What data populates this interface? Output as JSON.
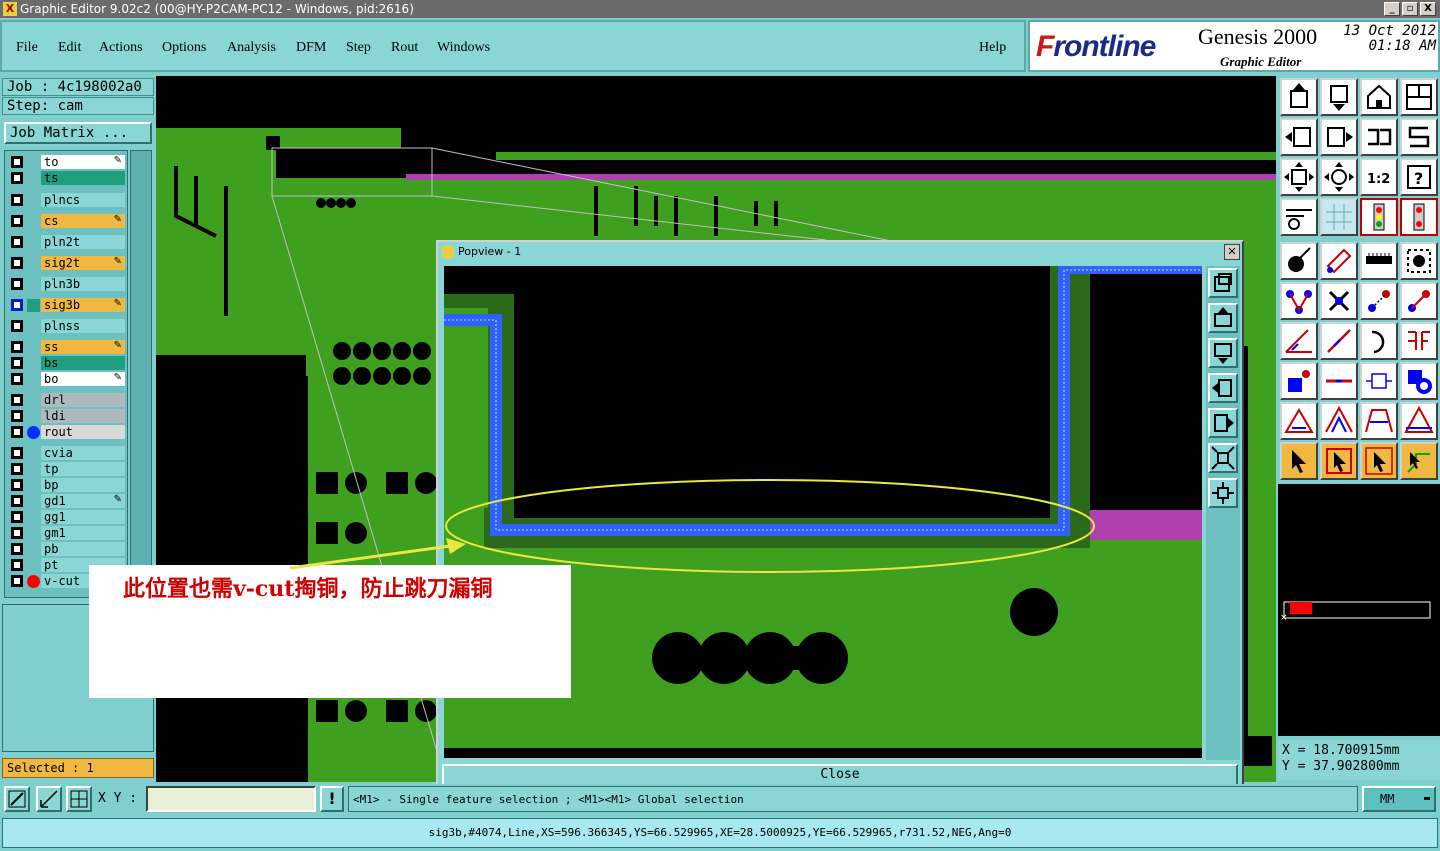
{
  "window": {
    "title": "Graphic Editor 9.02c2 (00@HY-P2CAM-PC12 - Windows, pid:2616)",
    "buttons": [
      "_",
      "▫",
      "X"
    ]
  },
  "menu": {
    "items": [
      "File",
      "Edit",
      "Actions",
      "Options",
      "Analysis",
      "DFM",
      "Step",
      "Rout",
      "Windows"
    ],
    "help": "Help"
  },
  "brand": {
    "logo_prefix": "F",
    "logo_rest": "rontline",
    "product": "Genesis 2000",
    "subtitle": "Graphic Editor",
    "date": "13 Oct 2012",
    "time": "01:18 AM"
  },
  "left": {
    "job": "Job : 4c198002a0",
    "step": "Step: cam",
    "job_matrix": "Job Matrix ...",
    "selected": "Selected : 1",
    "layers": [
      {
        "name": "to",
        "bg": "#ffffff",
        "editable": true
      },
      {
        "name": "ts",
        "bg": "#1f9f7f"
      },
      {
        "name": "plncs",
        "bg": "#8ad6d6"
      },
      {
        "name": "cs",
        "bg": "#f0b840",
        "editable": true
      },
      {
        "name": "pln2t",
        "bg": "#8ad6d6"
      },
      {
        "name": "sig2t",
        "bg": "#f0b840",
        "editable": true
      },
      {
        "name": "pln3b",
        "bg": "#8ad6d6"
      },
      {
        "name": "sig3b",
        "bg": "#f0b840",
        "editable": true,
        "work": true
      },
      {
        "name": "plnss",
        "bg": "#8ad6d6"
      },
      {
        "name": "ss",
        "bg": "#f0b840",
        "editable": true
      },
      {
        "name": "bs",
        "bg": "#1f9f7f"
      },
      {
        "name": "bo",
        "bg": "#ffffff",
        "editable": true
      },
      {
        "name": "drl",
        "bg": "#b0b8c0"
      },
      {
        "name": "ldi",
        "bg": "#b0b8c0"
      },
      {
        "name": "rout",
        "bg": "#d8d8d8",
        "marker": "#0030ff"
      },
      {
        "name": "cvia",
        "bg": "#8ad6d6"
      },
      {
        "name": "tp",
        "bg": "#8ad6d6"
      },
      {
        "name": "bp",
        "bg": "#8ad6d6"
      },
      {
        "name": "gd1",
        "bg": "#8ad6d6",
        "editable": true
      },
      {
        "name": "gg1",
        "bg": "#8ad6d6"
      },
      {
        "name": "gm1",
        "bg": "#8ad6d6"
      },
      {
        "name": "pb",
        "bg": "#8ad6d6"
      },
      {
        "name": "pt",
        "bg": "#8ad6d6"
      },
      {
        "name": "v-cut",
        "bg": "#8ad6d6",
        "marker": "#ff0000"
      }
    ]
  },
  "popview": {
    "title": "Popview - 1",
    "close": "Close"
  },
  "annotation": {
    "text": "此位置也需v-cut掏铜，防止跳刀漏铜"
  },
  "coords": {
    "x": "X  = 18.700915mm",
    "y": "Y  = 37.902800mm"
  },
  "bottom": {
    "xy_label": "X Y :",
    "xy_value": "",
    "hint": "<M1> - Single feature selection ; <M1><M1> Global selection",
    "units": "MM",
    "status": "sig3b,#4074,Line,XS=596.366345,YS=66.529965,XE=28.5000925,YE=66.529965,r731.52,NEG,Ang=0"
  },
  "colors": {
    "board_green": "#3f9f1f",
    "trace_blue": "#3060ff",
    "magenta": "#b040b0",
    "ellipse": "#e8e840",
    "annotation_red": "#d00000"
  }
}
